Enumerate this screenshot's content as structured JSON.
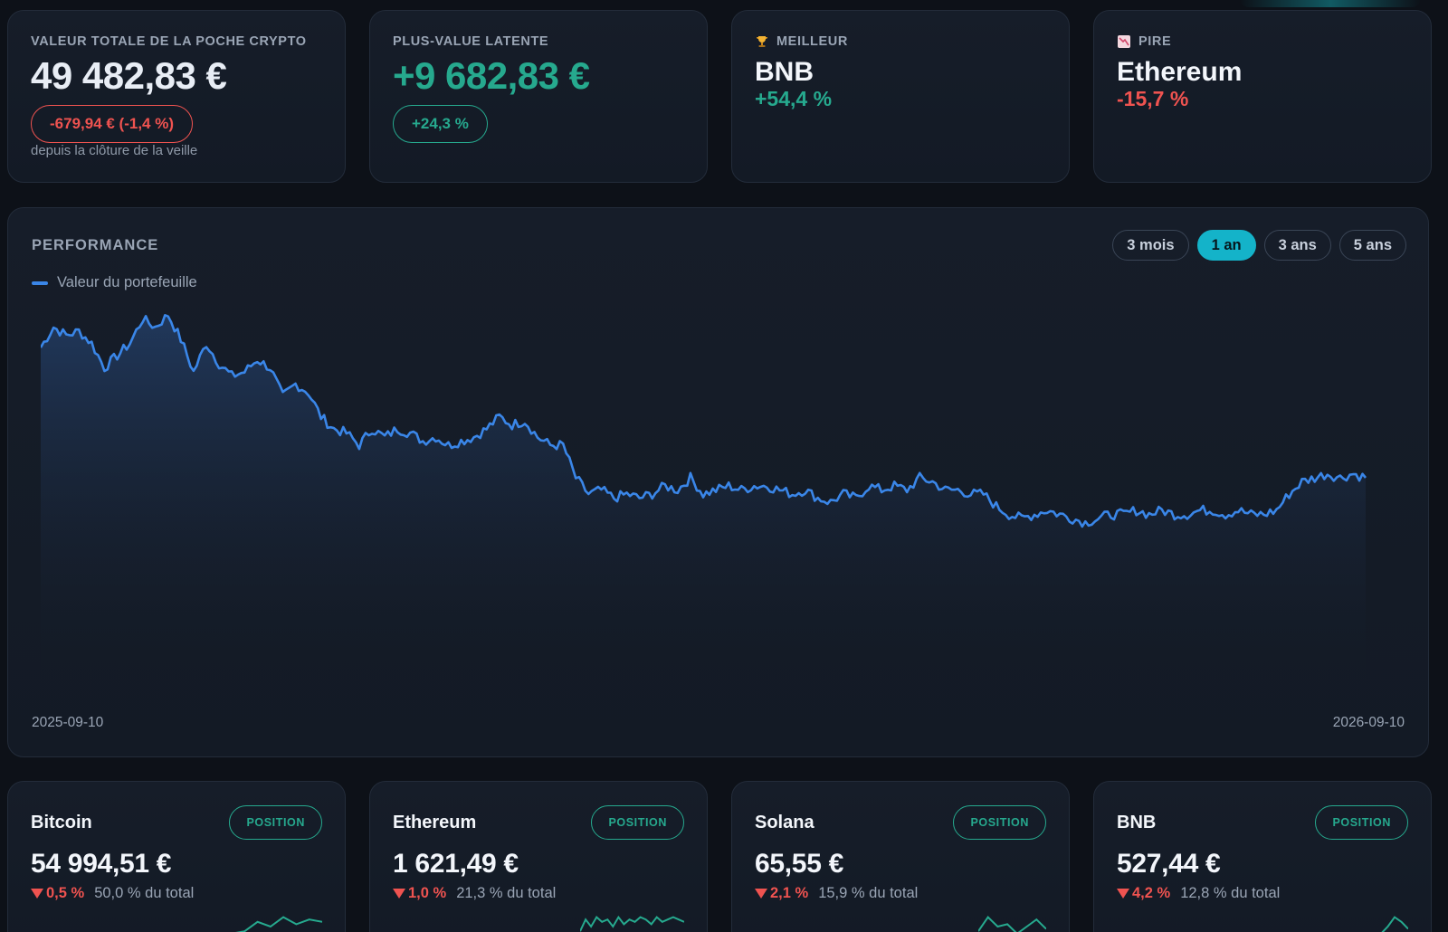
{
  "kpis": {
    "total": {
      "label": "VALEUR TOTALE DE LA POCHE CRYPTO",
      "value": "49 482,83 €",
      "change": "-679,94 € (-1,4 %)",
      "sub": "depuis la clôture de la veille"
    },
    "gain": {
      "label": "PLUS-VALUE LATENTE",
      "value": "+9 682,83 €",
      "pct": "+24,3 %"
    },
    "best": {
      "icon": "trophy-icon",
      "label": "MEILLEUR",
      "name": "BNB",
      "pct": "+54,4 %"
    },
    "worst": {
      "icon": "chart-down-icon",
      "label": "PIRE",
      "name": "Ethereum",
      "pct": "-15,7 %"
    }
  },
  "performance": {
    "title": "PERFORMANCE",
    "legend": "Valeur du portefeuille",
    "ranges": [
      {
        "label": "3 mois",
        "active": false
      },
      {
        "label": "1 an",
        "active": true
      },
      {
        "label": "3 ans",
        "active": false
      },
      {
        "label": "5 ans",
        "active": false
      }
    ],
    "start_date": "2025-09-10",
    "end_date": "2026-09-10"
  },
  "chart_data": {
    "type": "area",
    "series": [
      {
        "name": "Valeur du portefeuille",
        "values": [
          0.92,
          0.97,
          0.95,
          0.96,
          0.93,
          0.87,
          0.9,
          0.93,
          0.99,
          0.97,
          1.0,
          0.94,
          0.86,
          0.93,
          0.88,
          0.85,
          0.86,
          0.89,
          0.87,
          0.8,
          0.83,
          0.81,
          0.75,
          0.72,
          0.71,
          0.68,
          0.72,
          0.7,
          0.72,
          0.71,
          0.69,
          0.7,
          0.68,
          0.69,
          0.7,
          0.72,
          0.75,
          0.73,
          0.74,
          0.7,
          0.68,
          0.68,
          0.6,
          0.56,
          0.57,
          0.55,
          0.56,
          0.55,
          0.56,
          0.58,
          0.57,
          0.6,
          0.56,
          0.57,
          0.58,
          0.57,
          0.58,
          0.58,
          0.57,
          0.56,
          0.57,
          0.55,
          0.54,
          0.56,
          0.55,
          0.58,
          0.57,
          0.58,
          0.57,
          0.6,
          0.59,
          0.57,
          0.57,
          0.56,
          0.56,
          0.53,
          0.51,
          0.5,
          0.51,
          0.52,
          0.51,
          0.5,
          0.49,
          0.5,
          0.51,
          0.51,
          0.52,
          0.51,
          0.52,
          0.51,
          0.51,
          0.52,
          0.52,
          0.51,
          0.52,
          0.51,
          0.51,
          0.52,
          0.56,
          0.59,
          0.6,
          0.61,
          0.6,
          0.61,
          0.6
        ],
        "color": "#3a86e8"
      }
    ],
    "xlabel": "",
    "ylabel": "",
    "grid": false,
    "legend": "top-left"
  },
  "assets": [
    {
      "name": "Bitcoin",
      "badge": "POSITION",
      "price": "54 994,51 €",
      "change": "0,5 %",
      "share": "50,0 % du total",
      "spark": [
        0.2,
        0.3,
        0.7,
        0.5,
        0.9,
        0.6,
        0.8,
        0.7
      ]
    },
    {
      "name": "Ethereum",
      "badge": "POSITION",
      "price": "1 621,49 €",
      "change": "1,0 %",
      "share": "21,3 % du total",
      "spark": [
        0.3,
        0.8,
        0.5,
        0.9,
        0.7,
        0.8,
        0.5,
        0.9,
        0.6,
        0.8,
        0.7,
        0.9,
        0.8,
        0.6,
        0.9,
        0.7,
        0.8,
        0.9,
        0.8,
        0.7
      ]
    },
    {
      "name": "Solana",
      "badge": "POSITION",
      "price": "65,55 €",
      "change": "2,1 %",
      "share": "15,9 % du total",
      "spark": [
        0.3,
        0.9,
        0.5,
        0.6,
        0.2,
        0.5,
        0.8,
        0.4
      ]
    },
    {
      "name": "BNB",
      "badge": "POSITION",
      "price": "527,44 €",
      "change": "4,2 %",
      "share": "12,8 % du total",
      "spark": [
        0.2,
        0.5,
        0.9,
        0.7,
        0.4
      ]
    }
  ],
  "colors": {
    "accent": "#14b3c9",
    "positive": "#26a98e",
    "negative": "#ef5350",
    "line": "#3a86e8"
  }
}
